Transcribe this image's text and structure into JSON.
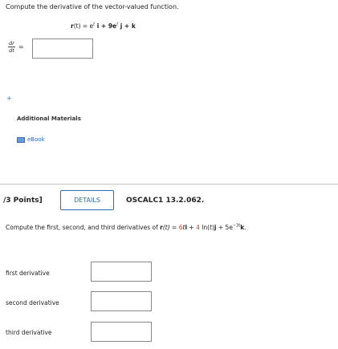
{
  "q1": {
    "prompt": "Compute the derivative of the vector-valued function.",
    "r_lhs": "r",
    "r_arg": "(t) = e",
    "exp1": "t",
    "i_part": " i + 9e",
    "exp2": "t",
    "j_part": " j + ",
    "k": "k",
    "frac_num": "dr",
    "frac_den": "dt",
    "equals": "=",
    "answer": ""
  },
  "help": {
    "plus": "+",
    "title": "Additional Materials",
    "ebook": "eBook"
  },
  "q2_header": {
    "points": "/3 Points]",
    "details": "DETAILS",
    "code": "OSCALC1 13.2.062."
  },
  "q2": {
    "prefix": "Compute the first, second, and third derivatives of ",
    "r": "r",
    "targ": "(t)",
    "eq": " = ",
    "c1": "6",
    "t1": "t",
    "i": "i",
    "plus1": " + ",
    "c2": "4",
    "ln": " ln(",
    "t2": "t",
    "ln_close": ")",
    "j": "j",
    "plus2": " + 5e",
    "exp": "−3t",
    "k": "k",
    "period": "."
  },
  "rows": [
    {
      "label": "first derivative",
      "value": ""
    },
    {
      "label": "second derivative",
      "value": ""
    },
    {
      "label": "third derivative",
      "value": ""
    }
  ],
  "colors": {
    "link": "#2a6cc2",
    "accent": "#2d6db5",
    "highlight": "#d23b2f"
  },
  "icons": [
    "ebook-icon"
  ]
}
